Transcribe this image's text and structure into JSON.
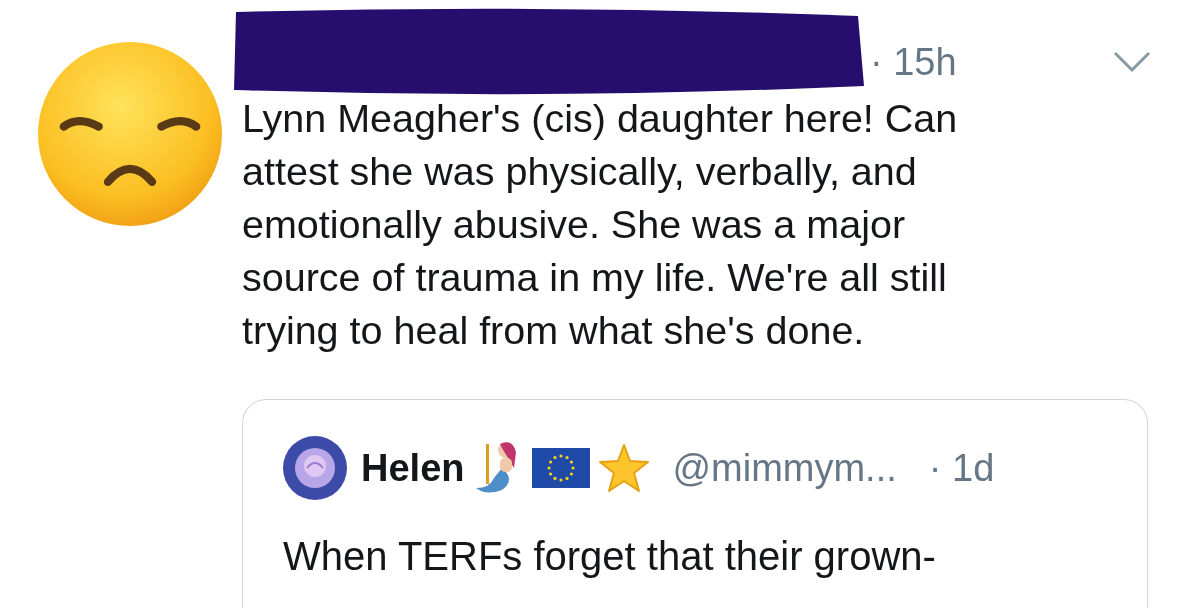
{
  "tweet": {
    "time": "· 15h",
    "text": "Lynn Meagher's (cis) daughter here! Can\nattest she was physically, verbally, and\nemotionally abusive. She was a major\nsource of trauma in my life. We're all still\ntrying to heal from what she's done.",
    "quoted": {
      "name": "Helen",
      "handle": "@mimmym...",
      "time": "· 1d",
      "text": "When TERFs forget that their grown-"
    }
  }
}
